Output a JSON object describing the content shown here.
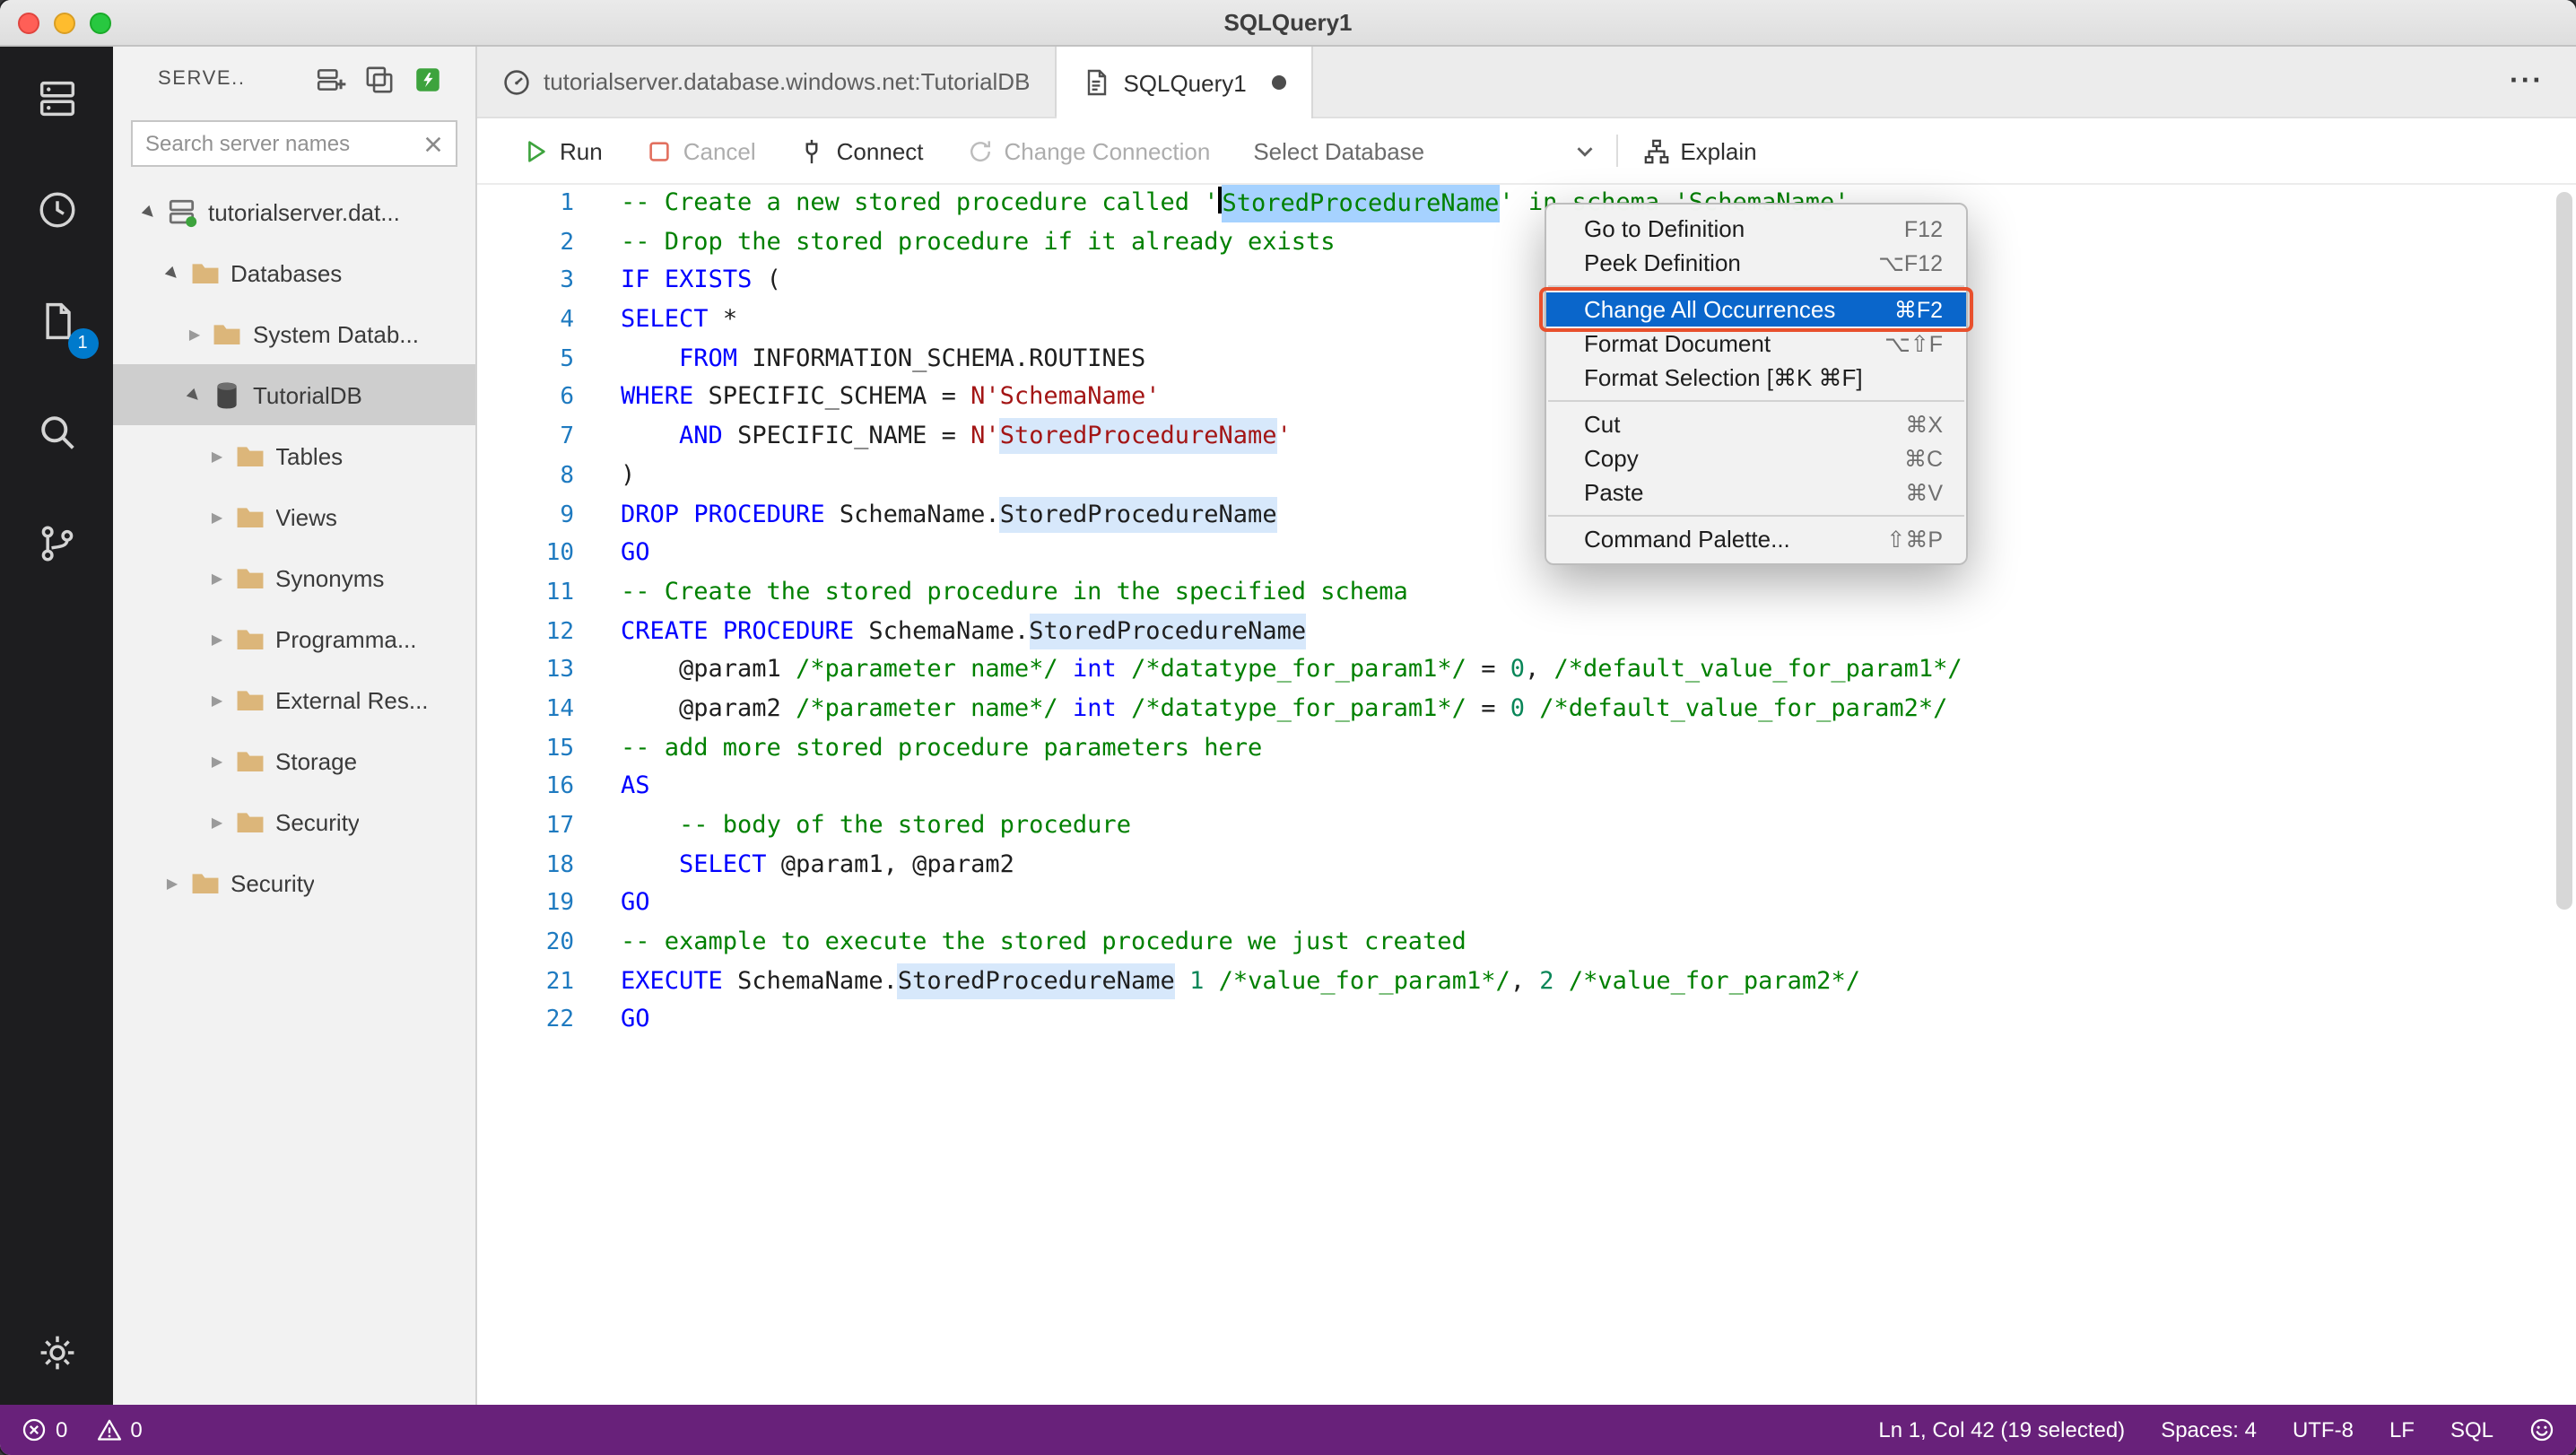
{
  "window": {
    "title": "SQLQuery1"
  },
  "colors": {
    "status_bar_background": "#68217a",
    "menu_highlight": "#0a66cb",
    "annotation_border": "#e8502d",
    "badge_background": "#007acc",
    "selection_background": "#a6d2ff",
    "keyword": "#0000ff",
    "comment": "#008000",
    "string": "#a31515",
    "number": "#098658",
    "line_number": "#1e7ac0",
    "folder_icon": "#dcb67a"
  },
  "activity_bar": {
    "items": [
      {
        "name": "connections",
        "icon": "server",
        "badge": null
      },
      {
        "name": "task-history",
        "icon": "clock",
        "badge": null
      },
      {
        "name": "open-editors",
        "icon": "file",
        "badge": "1"
      },
      {
        "name": "search",
        "icon": "search",
        "badge": null
      },
      {
        "name": "source-control",
        "icon": "git-branch",
        "badge": null
      }
    ],
    "bottom": [
      {
        "name": "settings",
        "icon": "gear"
      }
    ]
  },
  "sidebar": {
    "header": {
      "title": "SERVE..",
      "actions": [
        {
          "name": "new-connection"
        },
        {
          "name": "new-server-group"
        },
        {
          "name": "active-connections"
        }
      ]
    },
    "search": {
      "placeholder": "Search server names"
    },
    "tree": [
      {
        "label": "tutorialserver.dat...",
        "depth": 0,
        "caret": "expanded",
        "icon": "server-tree",
        "selected": false
      },
      {
        "label": "Databases",
        "depth": 1,
        "caret": "expanded",
        "icon": "folder",
        "selected": false
      },
      {
        "label": "System Datab...",
        "depth": 2,
        "caret": "collapsed",
        "icon": "folder",
        "selected": false
      },
      {
        "label": "TutorialDB",
        "depth": 2,
        "caret": "expanded",
        "icon": "database",
        "selected": true
      },
      {
        "label": "Tables",
        "depth": 3,
        "caret": "collapsed",
        "icon": "folder",
        "selected": false
      },
      {
        "label": "Views",
        "depth": 3,
        "caret": "collapsed",
        "icon": "folder",
        "selected": false
      },
      {
        "label": "Synonyms",
        "depth": 3,
        "caret": "collapsed",
        "icon": "folder",
        "selected": false
      },
      {
        "label": "Programma...",
        "depth": 3,
        "caret": "collapsed",
        "icon": "folder",
        "selected": false
      },
      {
        "label": "External Res...",
        "depth": 3,
        "caret": "collapsed",
        "icon": "folder",
        "selected": false
      },
      {
        "label": "Storage",
        "depth": 3,
        "caret": "collapsed",
        "icon": "folder",
        "selected": false
      },
      {
        "label": "Security",
        "depth": 3,
        "caret": "collapsed",
        "icon": "folder",
        "selected": false
      },
      {
        "label": "Security",
        "depth": 1,
        "caret": "collapsed",
        "icon": "folder",
        "selected": false
      }
    ]
  },
  "editor": {
    "tabs": [
      {
        "name": "dashboard-tab",
        "label": "tutorialserver.database.windows.net:TutorialDB",
        "icon": "dashboard",
        "active": false,
        "dirty": false
      },
      {
        "name": "query-tab",
        "label": "SQLQuery1",
        "icon": "sql-file",
        "active": true,
        "dirty": true
      }
    ],
    "tab_actions": "···",
    "toolbar": {
      "run": "Run",
      "cancel": "Cancel",
      "connect": "Connect",
      "change_connection": "Change Connection",
      "select_database": "Select Database",
      "explain": "Explain"
    },
    "lines": [
      {
        "n": 1,
        "segs": [
          {
            "t": "-- Create a new stored procedure called '",
            "c": "cm"
          },
          {
            "cursor": true
          },
          {
            "t": "StoredProcedureName",
            "c": "cm",
            "m": "sel"
          },
          {
            "t": "' in schema 'SchemaName'",
            "c": "cm"
          }
        ]
      },
      {
        "n": 2,
        "segs": [
          {
            "t": "-- Drop the stored procedure if it already exists",
            "c": "cm"
          }
        ]
      },
      {
        "n": 3,
        "segs": [
          {
            "t": "IF",
            "c": "kw"
          },
          {
            "t": " ",
            "c": "pl"
          },
          {
            "t": "EXISTS",
            "c": "kw"
          },
          {
            "t": " (",
            "c": "pl"
          }
        ]
      },
      {
        "n": 4,
        "segs": [
          {
            "t": "SELECT",
            "c": "kw"
          },
          {
            "t": " *",
            "c": "pl"
          }
        ]
      },
      {
        "n": 5,
        "segs": [
          {
            "t": "    ",
            "c": "pl"
          },
          {
            "t": "FROM",
            "c": "kw"
          },
          {
            "t": " INFORMATION_SCHEMA.ROUTINES",
            "c": "pl"
          }
        ]
      },
      {
        "n": 6,
        "segs": [
          {
            "t": "WHERE",
            "c": "kw"
          },
          {
            "t": " SPECIFIC_SCHEMA = ",
            "c": "pl"
          },
          {
            "t": "N'SchemaName'",
            "c": "str"
          }
        ]
      },
      {
        "n": 7,
        "segs": [
          {
            "t": "    ",
            "c": "pl"
          },
          {
            "t": "AND",
            "c": "kw"
          },
          {
            "t": " SPECIFIC_NAME = ",
            "c": "pl"
          },
          {
            "t": "N'",
            "c": "str"
          },
          {
            "t": "StoredProcedureName",
            "c": "str",
            "m": "occ"
          },
          {
            "t": "'",
            "c": "str"
          }
        ]
      },
      {
        "n": 8,
        "segs": [
          {
            "t": ")",
            "c": "pl"
          }
        ]
      },
      {
        "n": 9,
        "segs": [
          {
            "t": "DROP",
            "c": "kw"
          },
          {
            "t": " ",
            "c": "pl"
          },
          {
            "t": "PROCEDURE",
            "c": "kw"
          },
          {
            "t": " SchemaName.",
            "c": "pl"
          },
          {
            "t": "StoredProcedureName",
            "c": "pl",
            "m": "occ"
          }
        ]
      },
      {
        "n": 10,
        "segs": [
          {
            "t": "GO",
            "c": "kw"
          }
        ]
      },
      {
        "n": 11,
        "segs": [
          {
            "t": "-- Create the stored procedure in the specified schema",
            "c": "cm"
          }
        ]
      },
      {
        "n": 12,
        "segs": [
          {
            "t": "CREATE",
            "c": "kw"
          },
          {
            "t": " ",
            "c": "pl"
          },
          {
            "t": "PROCEDURE",
            "c": "kw"
          },
          {
            "t": " SchemaName.",
            "c": "pl"
          },
          {
            "t": "StoredProcedureName",
            "c": "pl",
            "m": "occ"
          }
        ]
      },
      {
        "n": 13,
        "segs": [
          {
            "t": "    @param1 ",
            "c": "pl"
          },
          {
            "t": "/*parameter name*/",
            "c": "cm"
          },
          {
            "t": " ",
            "c": "pl"
          },
          {
            "t": "int",
            "c": "kw"
          },
          {
            "t": " ",
            "c": "pl"
          },
          {
            "t": "/*datatype_for_param1*/",
            "c": "cm"
          },
          {
            "t": " = ",
            "c": "pl"
          },
          {
            "t": "0",
            "c": "num"
          },
          {
            "t": ", ",
            "c": "pl"
          },
          {
            "t": "/*default_value_for_param1*/",
            "c": "cm"
          }
        ]
      },
      {
        "n": 14,
        "segs": [
          {
            "t": "    @param2 ",
            "c": "pl"
          },
          {
            "t": "/*parameter name*/",
            "c": "cm"
          },
          {
            "t": " ",
            "c": "pl"
          },
          {
            "t": "int",
            "c": "kw"
          },
          {
            "t": " ",
            "c": "pl"
          },
          {
            "t": "/*datatype_for_param1*/",
            "c": "cm"
          },
          {
            "t": " = ",
            "c": "pl"
          },
          {
            "t": "0",
            "c": "num"
          },
          {
            "t": " ",
            "c": "pl"
          },
          {
            "t": "/*default_value_for_param2*/",
            "c": "cm"
          }
        ]
      },
      {
        "n": 15,
        "segs": [
          {
            "t": "-- add more stored procedure parameters here",
            "c": "cm"
          }
        ]
      },
      {
        "n": 16,
        "segs": [
          {
            "t": "AS",
            "c": "kw"
          }
        ]
      },
      {
        "n": 17,
        "segs": [
          {
            "t": "    ",
            "c": "pl"
          },
          {
            "t": "-- body of the stored procedure",
            "c": "cm"
          }
        ]
      },
      {
        "n": 18,
        "segs": [
          {
            "t": "    ",
            "c": "pl"
          },
          {
            "t": "SELECT",
            "c": "kw"
          },
          {
            "t": " @param1, @param2",
            "c": "pl"
          }
        ]
      },
      {
        "n": 19,
        "segs": [
          {
            "t": "GO",
            "c": "kw"
          }
        ]
      },
      {
        "n": 20,
        "segs": [
          {
            "t": "-- example to execute the stored procedure we just created",
            "c": "cm"
          }
        ]
      },
      {
        "n": 21,
        "segs": [
          {
            "t": "EXECUTE",
            "c": "kw"
          },
          {
            "t": " SchemaName.",
            "c": "pl"
          },
          {
            "t": "StoredProcedureName",
            "c": "pl",
            "m": "occ"
          },
          {
            "t": " ",
            "c": "pl"
          },
          {
            "t": "1",
            "c": "num"
          },
          {
            "t": " ",
            "c": "pl"
          },
          {
            "t": "/*value_for_param1*/",
            "c": "cm"
          },
          {
            "t": ", ",
            "c": "pl"
          },
          {
            "t": "2",
            "c": "num"
          },
          {
            "t": " ",
            "c": "pl"
          },
          {
            "t": "/*value_for_param2*/",
            "c": "cm"
          }
        ]
      },
      {
        "n": 22,
        "segs": [
          {
            "t": "GO",
            "c": "kw"
          }
        ]
      }
    ]
  },
  "context_menu": {
    "groups": [
      [
        {
          "label": "Go to Definition",
          "shortcut": "F12"
        },
        {
          "label": "Peek Definition",
          "shortcut": "⌥F12"
        }
      ],
      [
        {
          "label": "Change All Occurrences",
          "shortcut": "⌘F2",
          "highlighted": true,
          "annotated": true
        },
        {
          "label": "Format Document",
          "shortcut": "⌥⇧F"
        },
        {
          "label": "Format Selection [⌘K ⌘F]",
          "shortcut": ""
        }
      ],
      [
        {
          "label": "Cut",
          "shortcut": "⌘X"
        },
        {
          "label": "Copy",
          "shortcut": "⌘C"
        },
        {
          "label": "Paste",
          "shortcut": "⌘V"
        }
      ],
      [
        {
          "label": "Command Palette...",
          "shortcut": "⇧⌘P"
        }
      ]
    ]
  },
  "status_bar": {
    "errors": "0",
    "warnings": "0",
    "items_right": [
      {
        "name": "cursor-position",
        "label": "Ln 1, Col 42 (19 selected)"
      },
      {
        "name": "indentation",
        "label": "Spaces: 4"
      },
      {
        "name": "encoding",
        "label": "UTF-8"
      },
      {
        "name": "eol",
        "label": "LF"
      },
      {
        "name": "language-mode",
        "label": "SQL"
      }
    ]
  }
}
